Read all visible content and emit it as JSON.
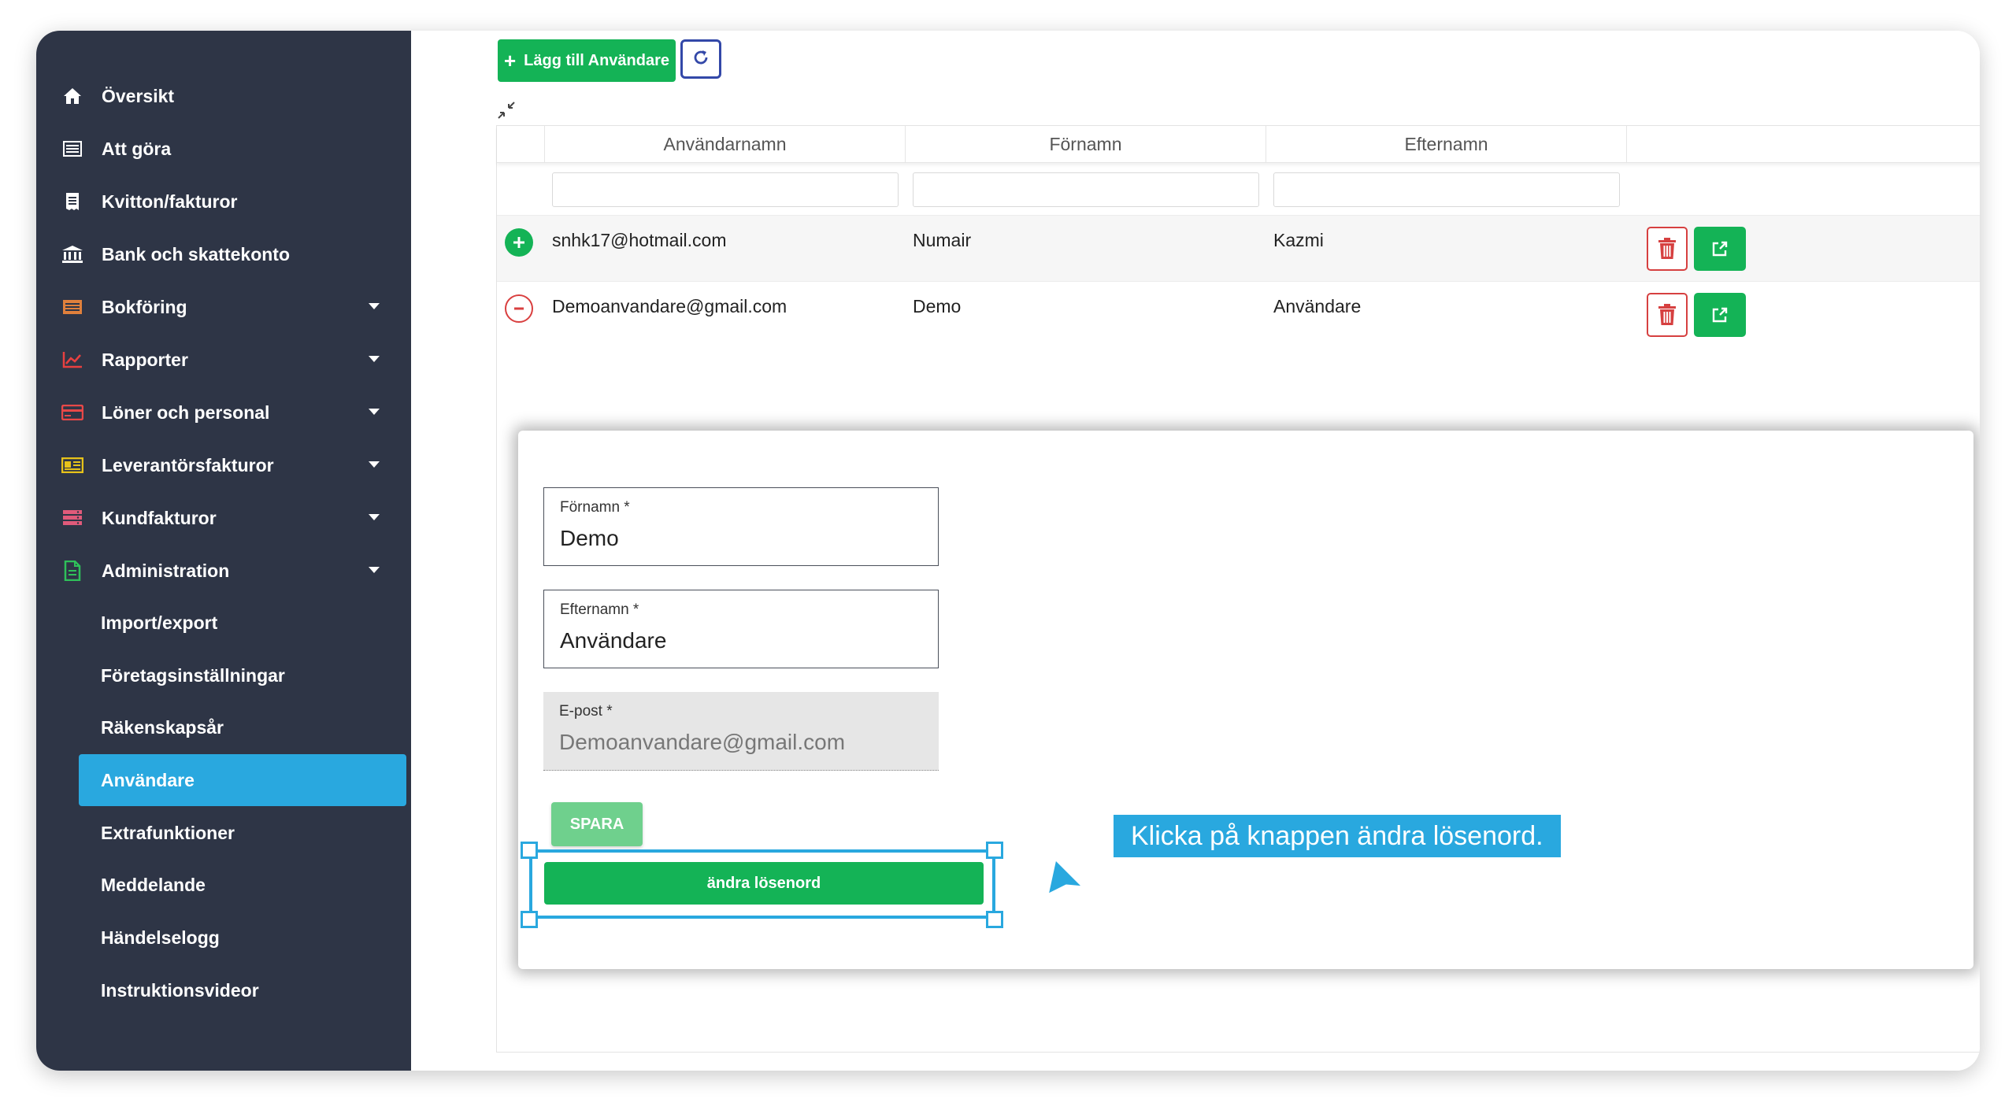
{
  "sidebar": {
    "items": [
      {
        "label": "Översikt",
        "icon": "home-icon",
        "has_caret": false
      },
      {
        "label": "Att göra",
        "icon": "list-icon",
        "has_caret": false
      },
      {
        "label": "Kvitton/fakturor",
        "icon": "receipt-icon",
        "has_caret": false
      },
      {
        "label": "Bank och skattekonto",
        "icon": "bank-icon",
        "has_caret": false
      },
      {
        "label": "Bokföring",
        "icon": "ledger-icon",
        "has_caret": true
      },
      {
        "label": "Rapporter",
        "icon": "chart-icon",
        "has_caret": true
      },
      {
        "label": "Löner och personal",
        "icon": "card-icon",
        "has_caret": true
      },
      {
        "label": "Leverantörsfakturor",
        "icon": "supplier-invoice-icon",
        "has_caret": true
      },
      {
        "label": "Kundfakturor",
        "icon": "customer-invoice-icon",
        "has_caret": true
      },
      {
        "label": "Administration",
        "icon": "admin-file-icon",
        "has_caret": true
      }
    ],
    "sub_items": [
      {
        "label": "Import/export",
        "active": false
      },
      {
        "label": "Företagsinställningar",
        "active": false
      },
      {
        "label": "Räkenskapsår",
        "active": false
      },
      {
        "label": "Användare",
        "active": true
      },
      {
        "label": "Extrafunktioner",
        "active": false
      },
      {
        "label": "Meddelande",
        "active": false
      },
      {
        "label": "Händelselogg",
        "active": false
      },
      {
        "label": "Instruktionsvideor",
        "active": false
      }
    ],
    "colors": {
      "background": "#2e3546",
      "active": "#29a8df"
    }
  },
  "toolbar": {
    "add_user_label": "Lägg till Användare",
    "add_icon": "plus-icon",
    "refresh_icon": "refresh-icon"
  },
  "table": {
    "columns": [
      "Användarnamn",
      "Förnamn",
      "Efternamn"
    ],
    "rows": [
      {
        "username": "snhk17@hotmail.com",
        "first_name": "Numair",
        "last_name": "Kazmi",
        "expanded": false
      },
      {
        "username": "Demoanvandare@gmail.com",
        "first_name": "Demo",
        "last_name": "Användare",
        "expanded": true
      }
    ]
  },
  "modal": {
    "first_name": {
      "label": "Förnamn *",
      "value": "Demo"
    },
    "last_name": {
      "label": "Efternamn *",
      "value": "Användare"
    },
    "email": {
      "label": "E-post *",
      "value": "Demoanvandare@gmail.com"
    },
    "save_label": "SPARA",
    "change_password_label": "ändra lösenord"
  },
  "tooltip": {
    "text": "Klicka på knappen ändra lösenord."
  },
  "colors": {
    "primary_green": "#14b356",
    "danger_red": "#d64040",
    "highlight_blue": "#29a8df"
  }
}
